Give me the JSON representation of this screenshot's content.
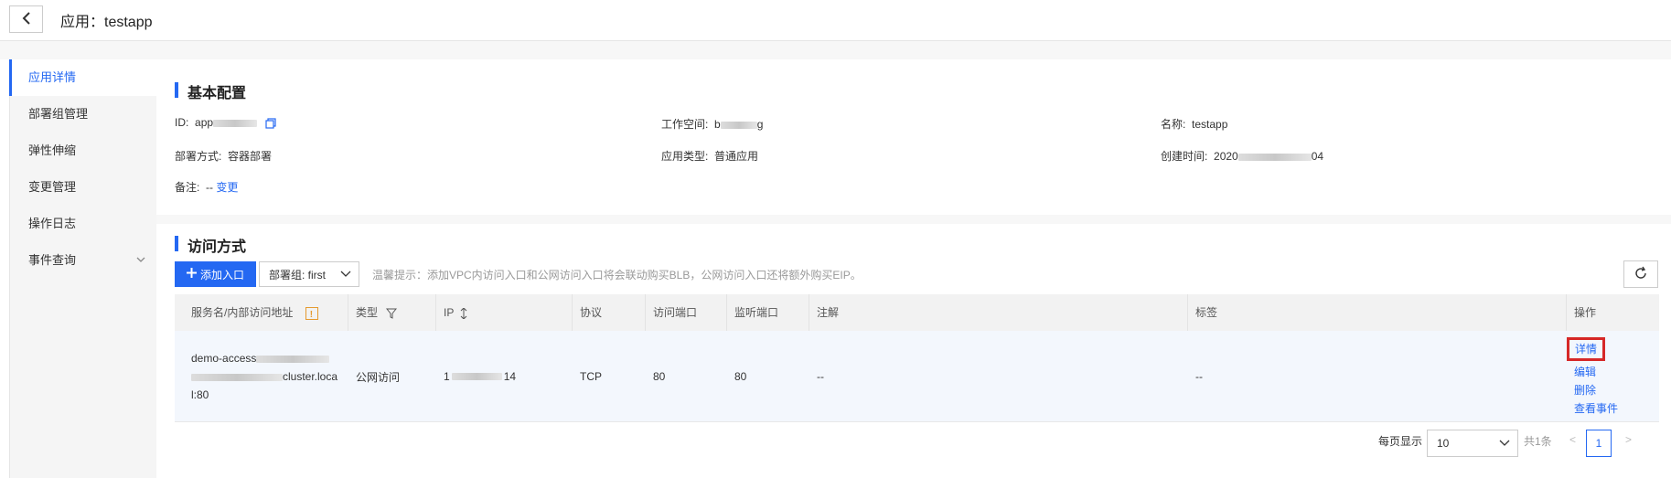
{
  "header": {
    "title": "应用：testapp"
  },
  "sidebar": {
    "items": [
      {
        "label": "应用详情"
      },
      {
        "label": "部署组管理"
      },
      {
        "label": "弹性伸缩"
      },
      {
        "label": "变更管理"
      },
      {
        "label": "操作日志"
      },
      {
        "label": "事件查询"
      }
    ]
  },
  "basic": {
    "title": "基本配置",
    "id_label": "ID:",
    "id_value": "app",
    "workspace_label": "工作空间:",
    "workspace_value_start": "b",
    "workspace_value_end": "g",
    "name_label": "名称:",
    "name_value": "testapp",
    "deploy_label": "部署方式:",
    "deploy_value": "容器部署",
    "type_label": "应用类型:",
    "type_value": "普通应用",
    "created_label": "创建时间:",
    "created_value_start": "2020",
    "created_value_end": "04",
    "remark_label": "备注:",
    "remark_value": "--",
    "remark_change": "变更"
  },
  "access": {
    "title": "访问方式",
    "add_button": "添加入口",
    "group_select": "部署组: first",
    "tip": "温馨提示：添加VPC内访问入口和公网访问入口将会联动购买BLB，公网访问入口还将额外购买EIP。"
  },
  "table": {
    "headers": [
      "服务名/内部访问地址",
      "类型",
      "IP",
      "协议",
      "访问端口",
      "监听端口",
      "注解",
      "标签",
      "操作"
    ],
    "row": {
      "service_line1": "demo-access",
      "service_line2": "cluster.loca",
      "service_line3": "l:80",
      "type": "公网访问",
      "ip_start": "1",
      "ip_end": "14",
      "protocol": "TCP",
      "access_port": "80",
      "listen_port": "80",
      "annotation": "--",
      "labels": "--",
      "ops": [
        "详情",
        "编辑",
        "删除",
        "查看事件"
      ]
    }
  },
  "pagination": {
    "per_page_label": "每页显示",
    "per_page_value": "10",
    "total": "共1条",
    "prev": "<",
    "current": "1",
    "next": ">"
  },
  "colors": {
    "accent": "#2468f2",
    "highlight": "#d62828"
  }
}
